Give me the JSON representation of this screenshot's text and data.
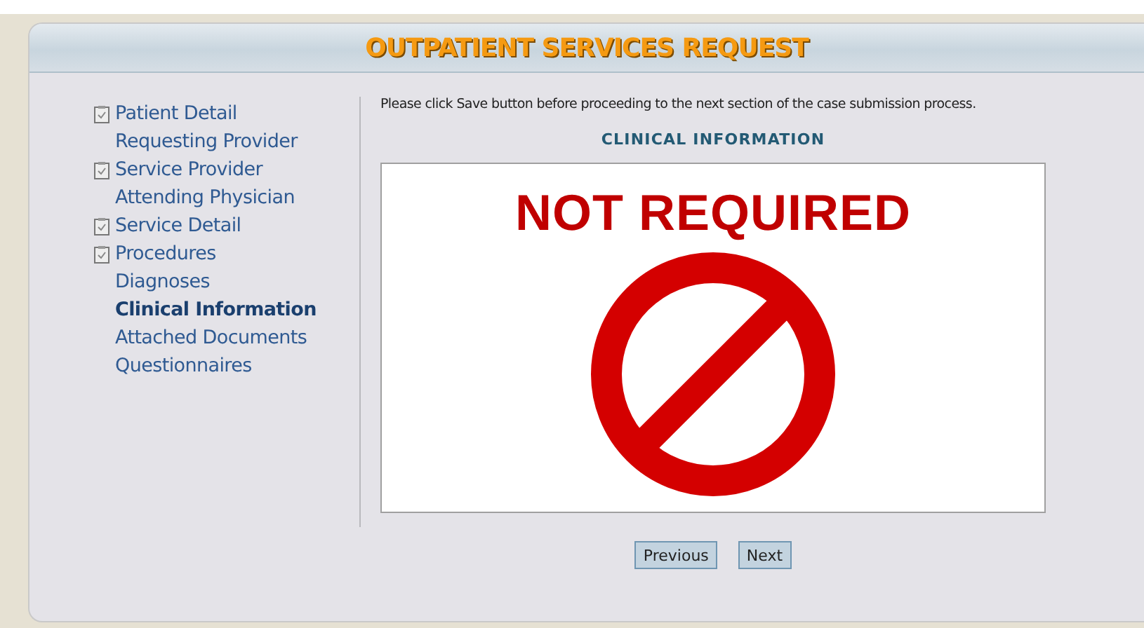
{
  "header": {
    "title": "OUTPATIENT SERVICES REQUEST"
  },
  "nav": [
    {
      "label": "Patient Detail",
      "completed": true,
      "selected": false
    },
    {
      "label": "Requesting Provider",
      "completed": false,
      "selected": false
    },
    {
      "label": "Service Provider",
      "completed": true,
      "selected": false
    },
    {
      "label": "Attending Physician",
      "completed": false,
      "selected": false
    },
    {
      "label": "Service Detail",
      "completed": true,
      "selected": false
    },
    {
      "label": "Procedures",
      "completed": true,
      "selected": false
    },
    {
      "label": "Diagnoses",
      "completed": false,
      "selected": false
    },
    {
      "label": "Clinical Information",
      "completed": false,
      "selected": true
    },
    {
      "label": "Attached Documents",
      "completed": false,
      "selected": false
    },
    {
      "label": "Questionnaires",
      "completed": false,
      "selected": false
    }
  ],
  "notice": "Please click Save button before proceeding to the next section of the case submission process.",
  "section_title": "CLINICAL INFORMATION",
  "clinical_box": {
    "stamp": "NOT REQUIRED"
  },
  "buttons": [
    "Previous",
    "Next"
  ]
}
